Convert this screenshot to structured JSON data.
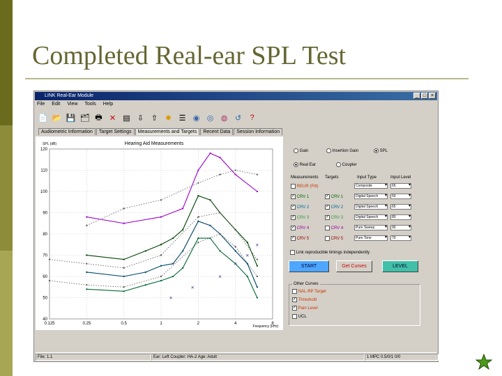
{
  "slide": {
    "title": "Completed Real-ear SPL Test"
  },
  "window": {
    "title": "LINK Real-Ear Module",
    "menu": [
      "File",
      "Edit",
      "View",
      "Tools",
      "Help"
    ],
    "toolbar_icons": [
      "new-icon",
      "open-icon",
      "save-icon",
      "save-as-icon",
      "print-icon",
      "close-icon",
      "list-icon",
      "import-icon",
      "export-icon",
      "bug-icon",
      "notes-icon",
      "nal-rp-icon",
      "dsl-icon",
      "hearing-aid-icon",
      "undo-icon",
      "help-icon"
    ],
    "tabs": [
      "Audiometric Information",
      "Target Settings",
      "Measurements and Targets",
      "Recent Data",
      "Session Information"
    ],
    "active_tab": 2,
    "graph_title": "Hearing Aid Measurements",
    "status": {
      "left": "File: 1.1",
      "mid": "Ear: Left  Coupler: HA-2  Age: Adult",
      "right": "1 MPC  0.5/0/1  0/0"
    }
  },
  "controls": {
    "mode": {
      "options": [
        "Gain",
        "Insertion Gain",
        "SPL"
      ],
      "selected": 2
    },
    "source": {
      "options": [
        "Real Ear",
        "Coupler"
      ],
      "selected": 0
    },
    "grid_headers": [
      "Measurements",
      "Targets",
      "Input Type",
      "Input Level"
    ],
    "rows": [
      {
        "label": "REUR (Fitt)",
        "meas_checked": false,
        "target": "",
        "target_checked": false,
        "input": "Composite",
        "level": "65"
      },
      {
        "label": "CRV 1",
        "meas_checked": true,
        "target": "CRV 1",
        "target_checked": true,
        "input": "Digital Speech",
        "level": "50"
      },
      {
        "label": "CRV 2",
        "meas_checked": true,
        "target": "CRV 2",
        "target_checked": true,
        "input": "Digital Speech",
        "level": "65"
      },
      {
        "label": "CRV 3",
        "meas_checked": true,
        "target": "CRV 3",
        "target_checked": true,
        "input": "Digital Speech",
        "level": "80"
      },
      {
        "label": "CRV 4",
        "meas_checked": true,
        "target": "CRV 4",
        "target_checked": false,
        "input": "Pure Sweep",
        "level": "90"
      },
      {
        "label": "CRV 5",
        "meas_checked": true,
        "target": "CRV 5",
        "target_checked": false,
        "input": "Pure Tone",
        "level": "70"
      }
    ],
    "independence_label": "Link reproducible timings independently",
    "start_label": "START",
    "get_curves_label": "Get Curves",
    "level_label": "LEVEL",
    "other_curves": {
      "title": "Other Curves",
      "items": [
        {
          "label": "NAL-RP Target",
          "checked": false,
          "color": "#cc3300"
        },
        {
          "label": "Threshold",
          "checked": true,
          "color": "#cc3300"
        },
        {
          "label": "Pain Level",
          "checked": true,
          "color": "#cc3300"
        },
        {
          "label": "UCL",
          "checked": false,
          "color": "#000000"
        }
      ]
    }
  },
  "chart_data": {
    "type": "line",
    "title": "Hearing Aid Measurements",
    "ylabel": "SPL (dB)",
    "xlabel": "Frequency (kHz)",
    "x_tick_labels": [
      "0.125",
      "0.25",
      "0.5",
      "1",
      "2",
      "4",
      "8"
    ],
    "y_tick_labels": [
      "120",
      "110",
      "100",
      "90",
      "80",
      "70",
      "60",
      "50",
      "40"
    ],
    "xlim": [
      0.125,
      8
    ],
    "ylim": [
      40,
      120
    ],
    "xscale": "log",
    "grid": true,
    "series": [
      {
        "color": "#9900cc",
        "style": "solid",
        "x": [
          0.25,
          0.5,
          1,
          1.5,
          2,
          2.5,
          3,
          4,
          6
        ],
        "y": [
          88,
          85,
          88,
          92,
          110,
          118,
          116,
          108,
          100
        ]
      },
      {
        "color": "#004400",
        "style": "solid",
        "x": [
          0.25,
          0.5,
          0.75,
          1,
          1.25,
          1.5,
          2,
          2.5,
          3,
          4,
          5,
          6
        ],
        "y": [
          70,
          68,
          72,
          75,
          78,
          82,
          98,
          96,
          90,
          82,
          76,
          65
        ]
      },
      {
        "color": "#004466",
        "style": "solid",
        "x": [
          0.25,
          0.5,
          0.75,
          1,
          1.25,
          1.5,
          2,
          2.5,
          3,
          4,
          5,
          6
        ],
        "y": [
          62,
          60,
          62,
          65,
          66,
          72,
          86,
          84,
          80,
          72,
          66,
          55
        ]
      },
      {
        "color": "#006633",
        "style": "solid",
        "x": [
          0.25,
          0.5,
          0.75,
          1,
          1.25,
          1.5,
          2,
          2.5,
          3,
          4,
          5,
          6
        ],
        "y": [
          54,
          53,
          56,
          58,
          60,
          64,
          78,
          78,
          72,
          66,
          60,
          50
        ]
      },
      {
        "color": "#555555",
        "style": "dotted",
        "x": [
          0.25,
          0.5,
          1,
          2,
          3,
          4,
          6
        ],
        "y": [
          84,
          92,
          96,
          104,
          108,
          110,
          108
        ]
      },
      {
        "color": "#555555",
        "style": "dotted",
        "x": [
          0.125,
          0.25,
          0.5,
          1,
          2,
          3,
          4,
          6
        ],
        "y": [
          68,
          66,
          64,
          70,
          88,
          90,
          82,
          68
        ]
      },
      {
        "color": "#555555",
        "style": "dotted",
        "x": [
          0.125,
          0.25,
          0.5,
          1,
          2,
          3,
          4,
          6
        ],
        "y": [
          58,
          56,
          55,
          60,
          76,
          80,
          74,
          60
        ]
      },
      {
        "color": "#333399",
        "style": "xmarks",
        "x": [
          1.2,
          1.8,
          3,
          4,
          5,
          6
        ],
        "y": [
          50,
          55,
          60,
          66,
          70,
          75
        ]
      }
    ]
  }
}
